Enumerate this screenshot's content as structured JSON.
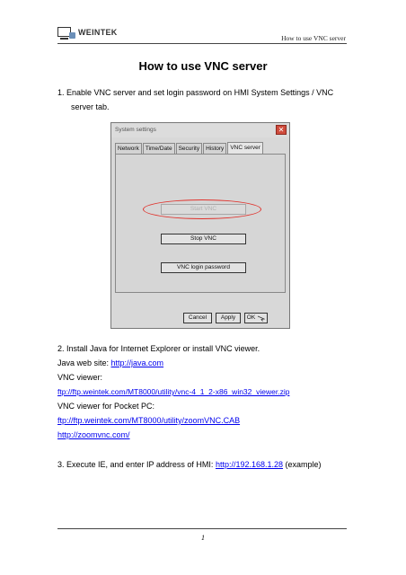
{
  "header": {
    "logo_text": "WEINTEK",
    "right_text": "How to use VNC server"
  },
  "title": "How to use VNC server",
  "step1": {
    "line1": "1.  Enable VNC server and set login password on HMI System Settings / VNC",
    "line2": "server tab."
  },
  "dialog": {
    "title": "System settings",
    "close_glyph": "✕",
    "tabs": [
      "Network",
      "Time/Date",
      "Security",
      "History",
      "VNC server"
    ],
    "start_label": "Start VNC",
    "stop_label": "Stop VNC",
    "password_label": "VNC login password",
    "cancel_label": "Cancel",
    "apply_label": "Apply",
    "ok_label": "OK"
  },
  "step2": {
    "heading": "2.  Install Java for Internet Explorer or install VNC viewer.",
    "java_label": "Java web site: ",
    "java_link": "http://java.com",
    "vnc_label": "VNC viewer:",
    "vnc_link": "ftp://ftp.weintek.com/MT8000/utility/vnc-4_1_2-x86_win32_viewer.zip",
    "pocket_label": "VNC viewer for Pocket PC:",
    "pocket_link1": "ftp://ftp.weintek.com/MT8000/utility/zoomVNC.CAB",
    "pocket_link2": "http://zoomvnc.com/"
  },
  "step3": {
    "text": "3. Execute IE, and enter IP address of HMI: ",
    "link": "http://192.168.1.28",
    "suffix": " (example)"
  },
  "page_number": "1"
}
